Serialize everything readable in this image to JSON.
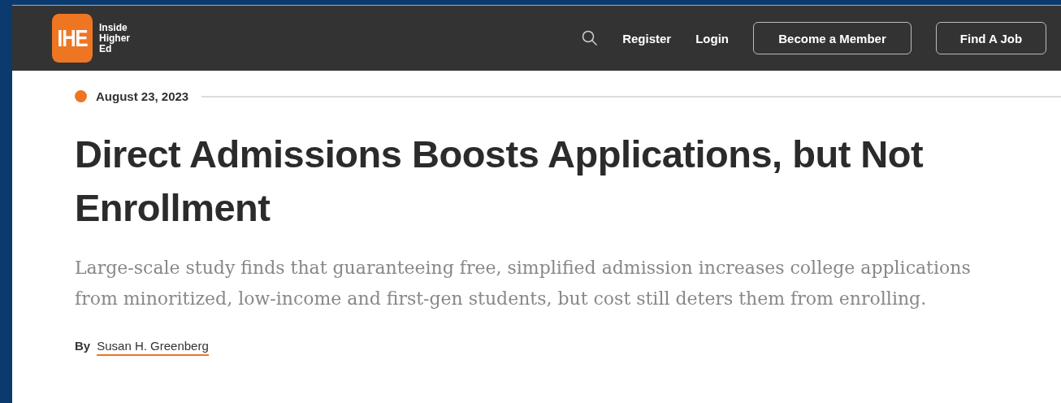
{
  "header": {
    "logo_mark": "IHE",
    "logo_text": [
      "Inside",
      "Higher",
      "Ed"
    ],
    "links": [
      "Register",
      "Login"
    ],
    "buttons": [
      "Become a Member",
      "Find A Job"
    ]
  },
  "article": {
    "date": "August 23, 2023",
    "title": "Direct Admissions Boosts Applications, but Not Enrollment",
    "summary": "Large-scale study finds that guaranteeing free, simplified admission increases college applications from minoritized, low-income and first-gen students, but cost still deters them from enrolling.",
    "byline_label": "By",
    "author": "Susan H. Greenberg"
  }
}
